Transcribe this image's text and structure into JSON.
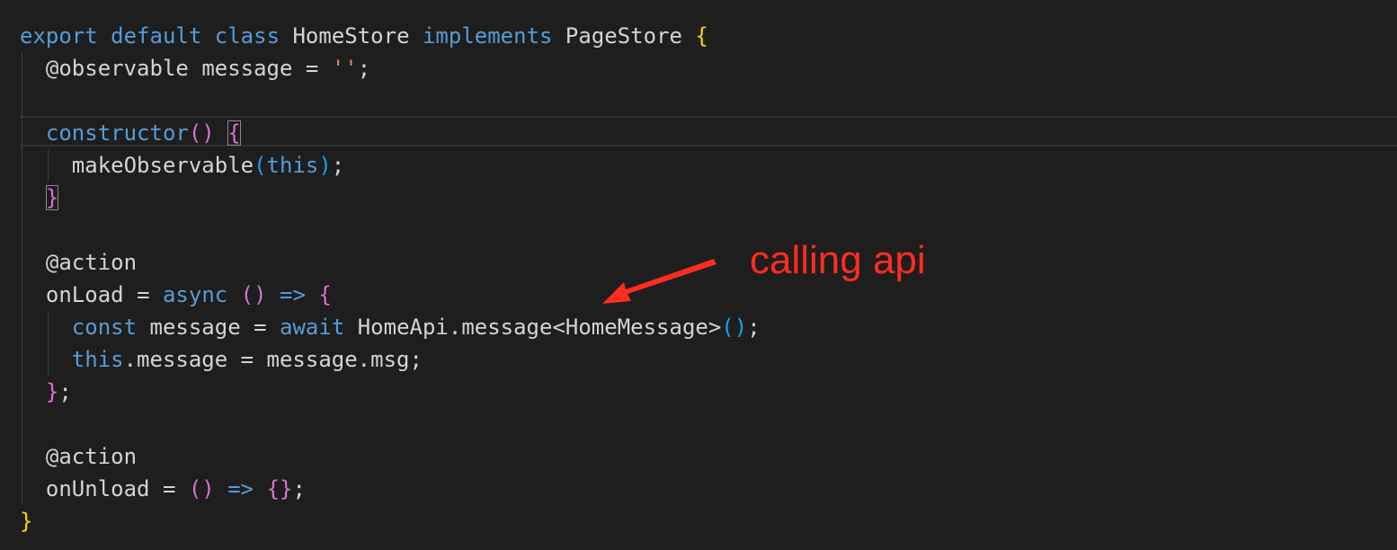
{
  "code": {
    "l1": {
      "export": "export",
      "default": "default",
      "class": "class",
      "name": "HomeStore",
      "implements": "implements",
      "iface": "PageStore",
      "brace": "{"
    },
    "l2": {
      "decorator": "@observable",
      "prop": "message",
      "eq": "=",
      "str": "''",
      "semi": ";"
    },
    "l4": {
      "ctor": "constructor",
      "paren": "()",
      "brace": "{"
    },
    "l5": {
      "fn": "makeObservable",
      "po": "(",
      "this": "this",
      "pc": ")",
      "semi": ";"
    },
    "l6": {
      "brace": "}"
    },
    "l8": {
      "decorator": "@action"
    },
    "l9": {
      "name": "onLoad",
      "eq": "=",
      "async": "async",
      "paren": "()",
      "arrow": "=>",
      "brace": "{"
    },
    "l10": {
      "const": "const",
      "var": "message",
      "eq": "=",
      "await": "await",
      "expr": "HomeApi.message<HomeMessage>",
      "paren": "()",
      "semi": ";"
    },
    "l11": {
      "this": "this",
      "rest": ".message = message.msg;"
    },
    "l12": {
      "brace": "}",
      "semi": ";"
    },
    "l14": {
      "decorator": "@action"
    },
    "l15": {
      "name": "onUnload",
      "eq": "=",
      "paren": "()",
      "arrow": "=>",
      "braces": "{}",
      "semi": ";"
    },
    "l16": {
      "brace": "}"
    }
  },
  "annotation": {
    "text": "calling api",
    "color": "#ff2d21"
  },
  "theme": {
    "background": "#1e1e1e",
    "keyword": "#569cd6",
    "keyword_control": "#c586c0",
    "text": "#d4d4d4",
    "bracket_level1": "#ffd700",
    "bracket_level2": "#da70d6",
    "bracket_level3": "#179fff"
  }
}
